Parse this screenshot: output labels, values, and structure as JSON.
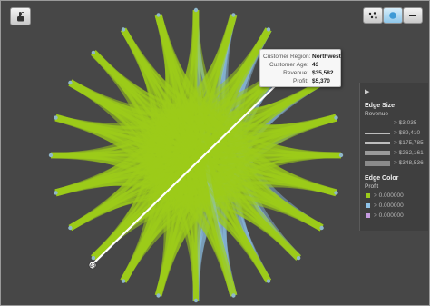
{
  "toolbar": {
    "left_icon": "pointer-hand-icon",
    "right_icons": [
      "scatter-layout-icon",
      "circle-layout-icon",
      "minus-icon"
    ]
  },
  "graph": {
    "colors": {
      "green": "#9ccc1a",
      "blue": "#8fc3e8",
      "node": "#8fb7c9",
      "highlight": "#ffffff"
    },
    "highlighted_node_label": "43"
  },
  "tooltip": {
    "rows": [
      {
        "key": "Customer Region:",
        "value": "Northwest"
      },
      {
        "key": "Customer Age:",
        "value": "43"
      },
      {
        "key": "Revenue:",
        "value": "$35,582"
      },
      {
        "key": "Profit:",
        "value": "$5,370"
      }
    ]
  },
  "legend": {
    "edge_size_title": "Edge Size",
    "edge_size_measure": "Revenue",
    "size_items": [
      {
        "label": "> $3,035"
      },
      {
        "label": "> $89,410"
      },
      {
        "label": "> $175,785"
      },
      {
        "label": "> $262,161"
      },
      {
        "label": "> $348,536"
      }
    ],
    "edge_color_title": "Edge Color",
    "edge_color_measure": "Profit",
    "color_items": [
      {
        "label": "> 0.000000",
        "color": "#9ccc1a"
      },
      {
        "label": "> 0.000000",
        "color": "#8fc3e8"
      },
      {
        "label": "> 0.000000",
        "color": "#c59be0"
      }
    ]
  }
}
